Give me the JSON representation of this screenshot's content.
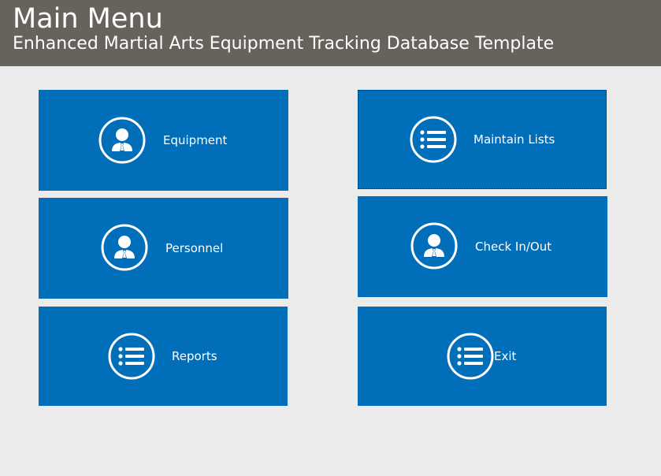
{
  "header": {
    "title": "Main Menu",
    "subtitle": "Enhanced Martial Arts Equipment Tracking Database Template"
  },
  "colors": {
    "header_bg": "#67625b",
    "background": "#ebebeb",
    "tile_bg": "#006eb9",
    "text": "#ffffff"
  },
  "menu": {
    "equipment": {
      "label": "Equipment",
      "icon": "person-icon"
    },
    "personnel": {
      "label": "Personnel",
      "icon": "person-icon"
    },
    "reports": {
      "label": "Reports",
      "icon": "list-icon"
    },
    "maintain_lists": {
      "label": "Maintain Lists",
      "icon": "list-icon"
    },
    "check_in_out": {
      "label": "Check In/Out",
      "icon": "person-icon"
    },
    "exit": {
      "label": "Exit",
      "icon": "list-icon"
    }
  }
}
